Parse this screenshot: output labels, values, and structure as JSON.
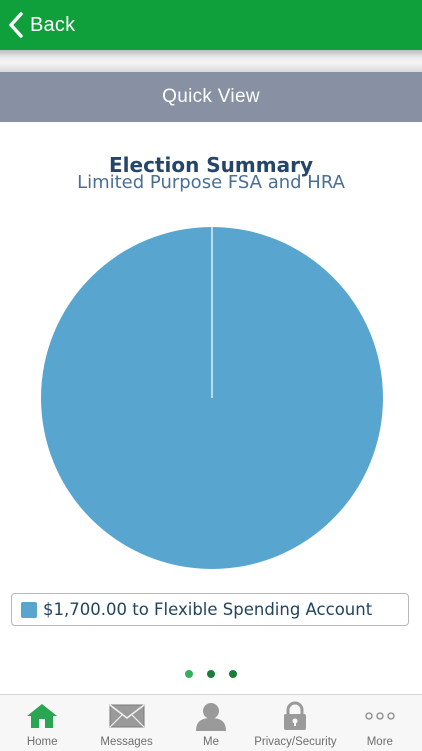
{
  "header": {
    "back_label": "Back"
  },
  "quick_view": {
    "title": "Quick View"
  },
  "summary": {
    "title": "Election Summary",
    "subtitle": "Limited Purpose FSA and HRA",
    "legend_label": "$1,700.00 to Flexible Spending Account"
  },
  "chart_data": {
    "type": "pie",
    "title": "Election Summary",
    "subtitle": "Limited Purpose FSA and HRA",
    "slices": [
      {
        "label": "$1,700.00 to Flexible Spending Account",
        "value": 1700,
        "color": "#58a6d0"
      }
    ],
    "legend": "bottom"
  },
  "pager": {
    "count": 3,
    "active_index": 0
  },
  "tabs": [
    {
      "label": "Home",
      "icon": "home-icon",
      "active": true
    },
    {
      "label": "Messages",
      "icon": "envelope-icon",
      "active": false
    },
    {
      "label": "Me",
      "icon": "person-icon",
      "active": false
    },
    {
      "label": "Privacy/Security",
      "icon": "lock-icon",
      "active": false
    },
    {
      "label": "More",
      "icon": "ellipsis-icon",
      "active": false
    }
  ],
  "colors": {
    "header_green": "#0f9f3b",
    "quickview_gray": "#8791a3",
    "pie_blue": "#58a6d0",
    "active_tab": "#19a144",
    "title_navy": "#24466b"
  }
}
